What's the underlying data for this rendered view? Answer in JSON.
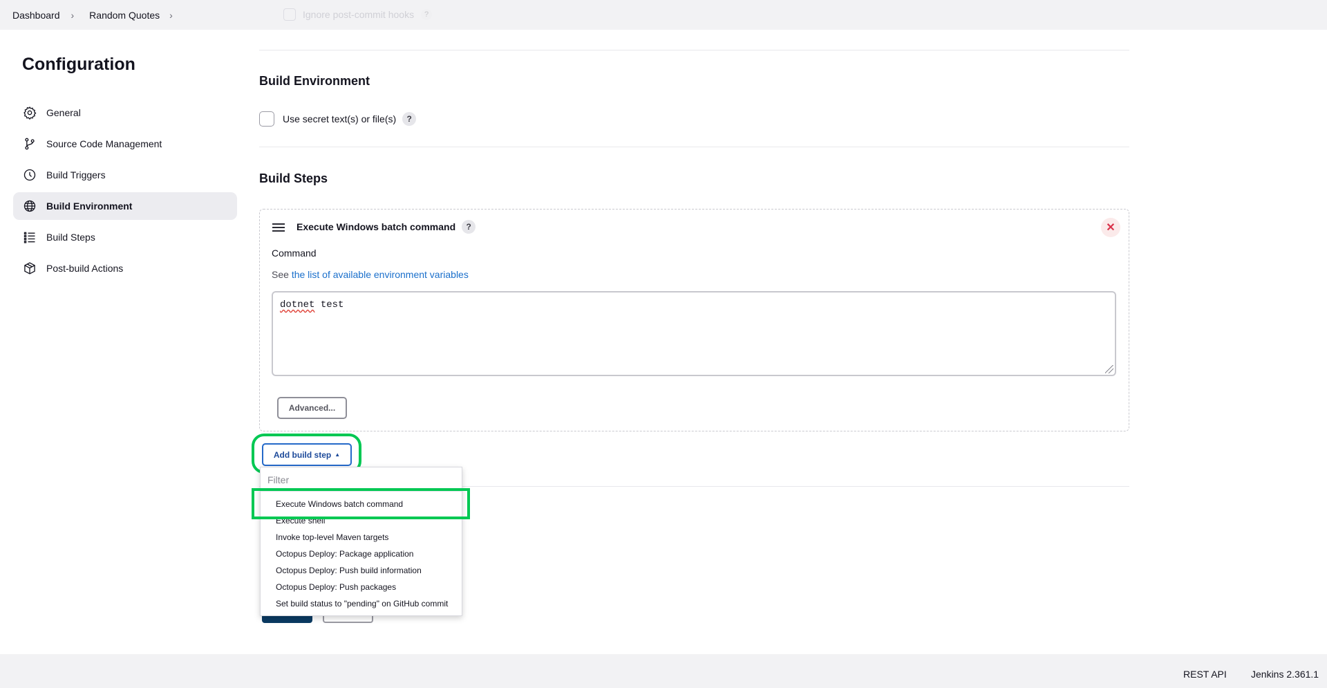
{
  "breadcrumb": {
    "items": [
      "Dashboard",
      "Random Quotes"
    ]
  },
  "ghost": {
    "hooks_label": "Ignore post-commit hooks"
  },
  "sidebar": {
    "title": "Configuration",
    "items": [
      {
        "label": "General",
        "icon": "gear-icon"
      },
      {
        "label": "Source Code Management",
        "icon": "branch-icon"
      },
      {
        "label": "Build Triggers",
        "icon": "clock-icon"
      },
      {
        "label": "Build Environment",
        "icon": "globe-icon",
        "active": true
      },
      {
        "label": "Build Steps",
        "icon": "list-icon"
      },
      {
        "label": "Post-build Actions",
        "icon": "package-icon"
      }
    ]
  },
  "build_environment": {
    "title": "Build Environment",
    "secret_checkbox_label": "Use secret text(s) or file(s)",
    "help": "?"
  },
  "build_steps": {
    "title": "Build Steps",
    "step": {
      "title": "Execute Windows batch command",
      "help": "?",
      "close": "✕",
      "command_label": "Command",
      "see_prefix": "See",
      "see_link": "the list of available environment variables",
      "command_word1": "dotnet",
      "command_word2": " test",
      "advanced_label": "Advanced..."
    },
    "add_button_label": "Add build step",
    "add_button_caret": "▲",
    "filter_placeholder": "Filter",
    "menu_items": [
      "Execute Windows batch command",
      "Execute shell",
      "Invoke top-level Maven targets",
      "Octopus Deploy: Package application",
      "Octopus Deploy: Push build information",
      "Octopus Deploy: Push packages",
      "Set build status to \"pending\" on GitHub commit"
    ]
  },
  "footer": {
    "rest_api": "REST API",
    "version": "Jenkins 2.361.1"
  },
  "colors": {
    "accent": "#2469c9",
    "highlight": "#00c853",
    "danger": "#d9324a"
  }
}
